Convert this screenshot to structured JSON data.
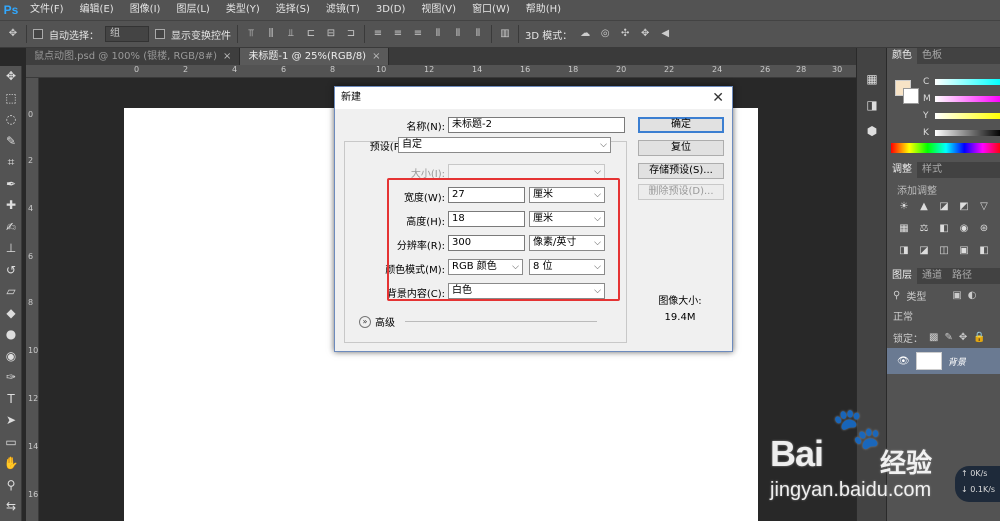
{
  "app": {
    "logo": "Ps"
  },
  "menu": [
    "文件(F)",
    "编辑(E)",
    "图像(I)",
    "图层(L)",
    "类型(Y)",
    "选择(S)",
    "滤镜(T)",
    "3D(D)",
    "视图(V)",
    "窗口(W)",
    "帮助(H)"
  ],
  "options_bar": {
    "auto_select_label": "自动选择：",
    "auto_select_value": "组",
    "show_transform_label": "显示变换控件",
    "mode_3d_label": "3D 模式："
  },
  "tabs": [
    {
      "label": "鼠点动图.psd @ 100% (银楼, RGB/8#)",
      "close": "×"
    },
    {
      "label": "未标题-1 @ 25%(RGB/8)",
      "close": "×"
    }
  ],
  "ruler_top": [
    "0",
    "2",
    "4",
    "6",
    "8",
    "10",
    "12",
    "14",
    "16",
    "18",
    "20",
    "22",
    "24",
    "26",
    "28",
    "30"
  ],
  "ruler_left": [
    "0",
    "2",
    "4",
    "6",
    "8",
    "10",
    "12",
    "14",
    "16"
  ],
  "dialog": {
    "title": "新建",
    "close": "✕",
    "name_label": "名称(N):",
    "name_value": "未标题-2",
    "preset_label": "预设(P):",
    "preset_value": "自定",
    "size_label": "大小(I):",
    "width_label": "宽度(W):",
    "width_value": "27",
    "width_unit": "厘米",
    "height_label": "高度(H):",
    "height_value": "18",
    "height_unit": "厘米",
    "resolution_label": "分辨率(R):",
    "resolution_value": "300",
    "resolution_unit": "像素/英寸",
    "color_mode_label": "颜色模式(M):",
    "color_mode_value": "RGB 颜色",
    "bit_depth_value": "8 位",
    "background_label": "背景内容(C):",
    "background_value": "白色",
    "advanced_label": "高级",
    "buttons": {
      "ok": "确定",
      "reset": "复位",
      "save_preset": "存储预设(S)...",
      "delete_preset": "删除预设(D)..."
    },
    "image_size_label": "图像大小:",
    "image_size_value": "19.4M"
  },
  "right_panel": {
    "color_tabs": [
      "颜色",
      "色板"
    ],
    "slider_labels": [
      "C",
      "M",
      "Y",
      "K"
    ],
    "adjust_tabs": [
      "调整",
      "样式"
    ],
    "adjust_hint": "添加调整",
    "layers_tabs": [
      "图层",
      "通道",
      "路径"
    ],
    "layer_filter": "类型",
    "blend_mode": "正常",
    "lock_label": "锁定：",
    "layer_name": "背景"
  },
  "watermark": {
    "brand": "Bai",
    "paw": "🐾",
    "brand2": "经验",
    "url": "jingyan.baidu.com"
  },
  "netspeed": {
    "up": "0K/s",
    "down": "0.1K/s"
  },
  "colors": {
    "accent": "#3c7fd1",
    "highlight": "#e53333",
    "foreground": "#f7e3c6"
  }
}
